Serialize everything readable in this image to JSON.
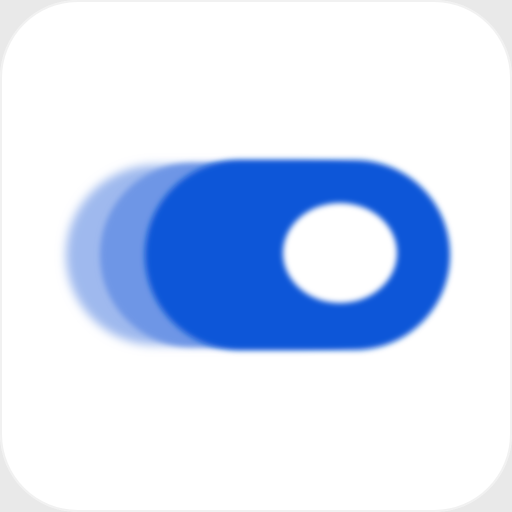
{
  "app_icon": {
    "icon": "toggle-switch-icon",
    "state": "on",
    "colors": {
      "tile": "#ffffff",
      "track": "#0a56d8",
      "knob": "#ffffff",
      "trail_light": "#9fb9ee",
      "trail_mid": "#6e96e6"
    }
  }
}
